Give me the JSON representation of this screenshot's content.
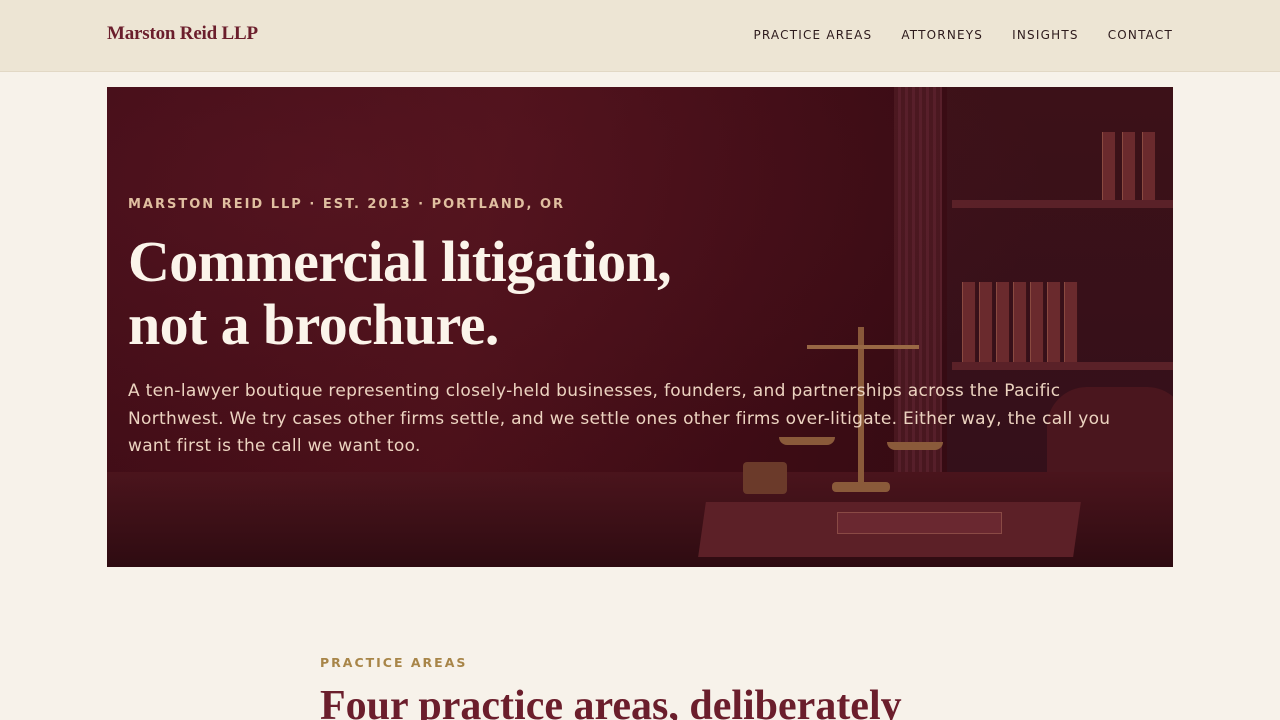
{
  "header": {
    "brand": "Marston Reid LLP",
    "nav": [
      "PRACTICE AREAS",
      "ATTORNEYS",
      "INSIGHTS",
      "CONTACT"
    ]
  },
  "hero": {
    "eyebrow": "MARSTON REID LLP · EST. 2013 · PORTLAND, OR",
    "headline_line1": "Commercial litigation,",
    "headline_line2": "not a brochure.",
    "lede": "A ten-lawyer boutique representing closely-held businesses, founders, and partnerships across the Pacific Northwest. We try cases other firms settle, and we settle ones other firms over-litigate. Either way, the call you want first is the call we want too."
  },
  "practice": {
    "eyebrow": "PRACTICE AREAS",
    "title": "Four practice areas, deliberately"
  },
  "colors": {
    "brand": "#6b1e2c",
    "hero_bg": "#3f0c16",
    "accent_gold": "#a88548",
    "page_bg": "#f7f2ea",
    "topbar_bg": "#ede5d4"
  }
}
